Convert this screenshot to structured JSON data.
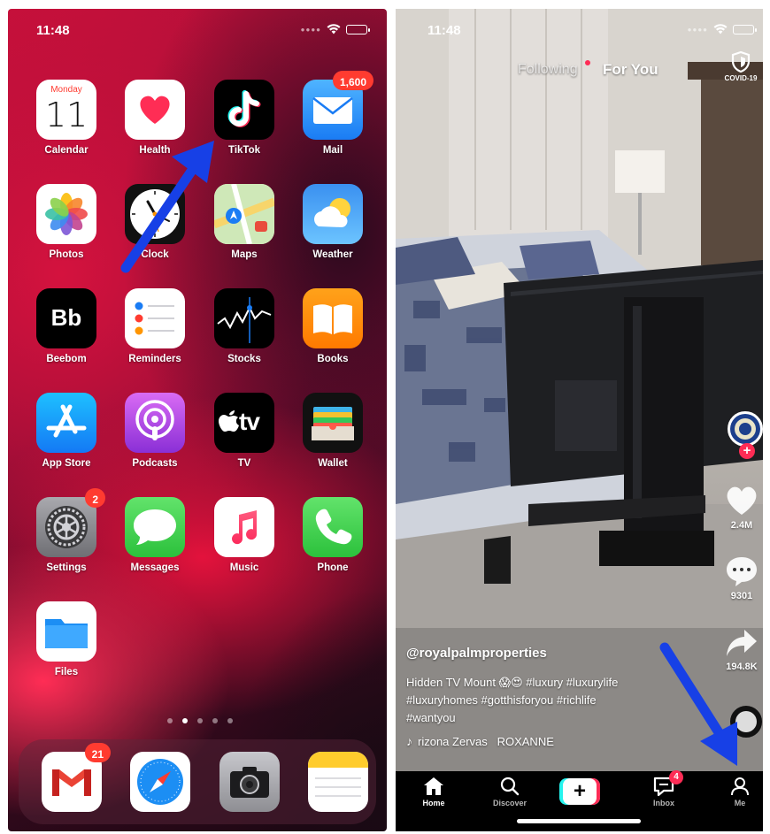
{
  "home_screen": {
    "status_bar": {
      "time": "11:48"
    },
    "apps": [
      {
        "id": "calendar",
        "label": "Calendar",
        "icon": "calendar-icon",
        "day": "Monday",
        "date": "11"
      },
      {
        "id": "health",
        "label": "Health",
        "icon": "heart-icon"
      },
      {
        "id": "tiktok",
        "label": "TikTok",
        "icon": "tiktok-icon"
      },
      {
        "id": "mail",
        "label": "Mail",
        "icon": "mail-icon",
        "badge": "1,600"
      },
      {
        "id": "photos",
        "label": "Photos",
        "icon": "photos-icon"
      },
      {
        "id": "clock",
        "label": "Clock",
        "icon": "clock-icon"
      },
      {
        "id": "maps",
        "label": "Maps",
        "icon": "maps-icon"
      },
      {
        "id": "weather",
        "label": "Weather",
        "icon": "weather-icon"
      },
      {
        "id": "beebom",
        "label": "Beebom",
        "icon": "beebom-icon",
        "glyph": "Bb"
      },
      {
        "id": "reminders",
        "label": "Reminders",
        "icon": "reminders-icon"
      },
      {
        "id": "stocks",
        "label": "Stocks",
        "icon": "stocks-icon"
      },
      {
        "id": "books",
        "label": "Books",
        "icon": "books-icon"
      },
      {
        "id": "appstore",
        "label": "App Store",
        "icon": "app-store-icon"
      },
      {
        "id": "podcasts",
        "label": "Podcasts",
        "icon": "podcasts-icon"
      },
      {
        "id": "tv",
        "label": "TV",
        "icon": "apple-tv-icon",
        "glyph": "tv"
      },
      {
        "id": "wallet",
        "label": "Wallet",
        "icon": "wallet-icon"
      },
      {
        "id": "settings",
        "label": "Settings",
        "icon": "settings-gear-icon",
        "badge": "2"
      },
      {
        "id": "messages",
        "label": "Messages",
        "icon": "messages-icon"
      },
      {
        "id": "music",
        "label": "Music",
        "icon": "music-note-icon"
      },
      {
        "id": "phone",
        "label": "Phone",
        "icon": "phone-icon"
      },
      {
        "id": "files",
        "label": "Files",
        "icon": "folder-icon"
      }
    ],
    "dock": [
      {
        "id": "gmail",
        "icon": "gmail-icon",
        "badge": "21"
      },
      {
        "id": "safari",
        "icon": "safari-compass-icon"
      },
      {
        "id": "camera",
        "icon": "camera-icon"
      },
      {
        "id": "notes",
        "icon": "notes-icon"
      }
    ],
    "page_dots": {
      "count": 5,
      "active_index": 1
    }
  },
  "tiktok": {
    "status_bar": {
      "time": "11:48"
    },
    "top_tabs": {
      "following": "Following",
      "for_you": "For You"
    },
    "covid_label": "COVID-19",
    "username": "@royalpalmproperties",
    "caption_line1": "Hidden TV Mount 😱😍 #luxury #luxurylife",
    "caption_line2": "#luxuryhomes #gotthisforyou #richlife",
    "caption_line3": "#wantyou",
    "sound_text": "rizona Zervas   ROXANNE",
    "likes": "2.4M",
    "comments": "9301",
    "shares": "194.8K",
    "nav": {
      "home": "Home",
      "discover": "Discover",
      "inbox": "Inbox",
      "inbox_badge": "4",
      "me": "Me"
    }
  },
  "colors": {
    "wallpaper_red": "#c3103a",
    "annotation_arrow": "#1740e6",
    "badge_red": "#ff3b30",
    "tiktok_red": "#fe2c55",
    "tiktok_cyan": "#25f4ee"
  }
}
